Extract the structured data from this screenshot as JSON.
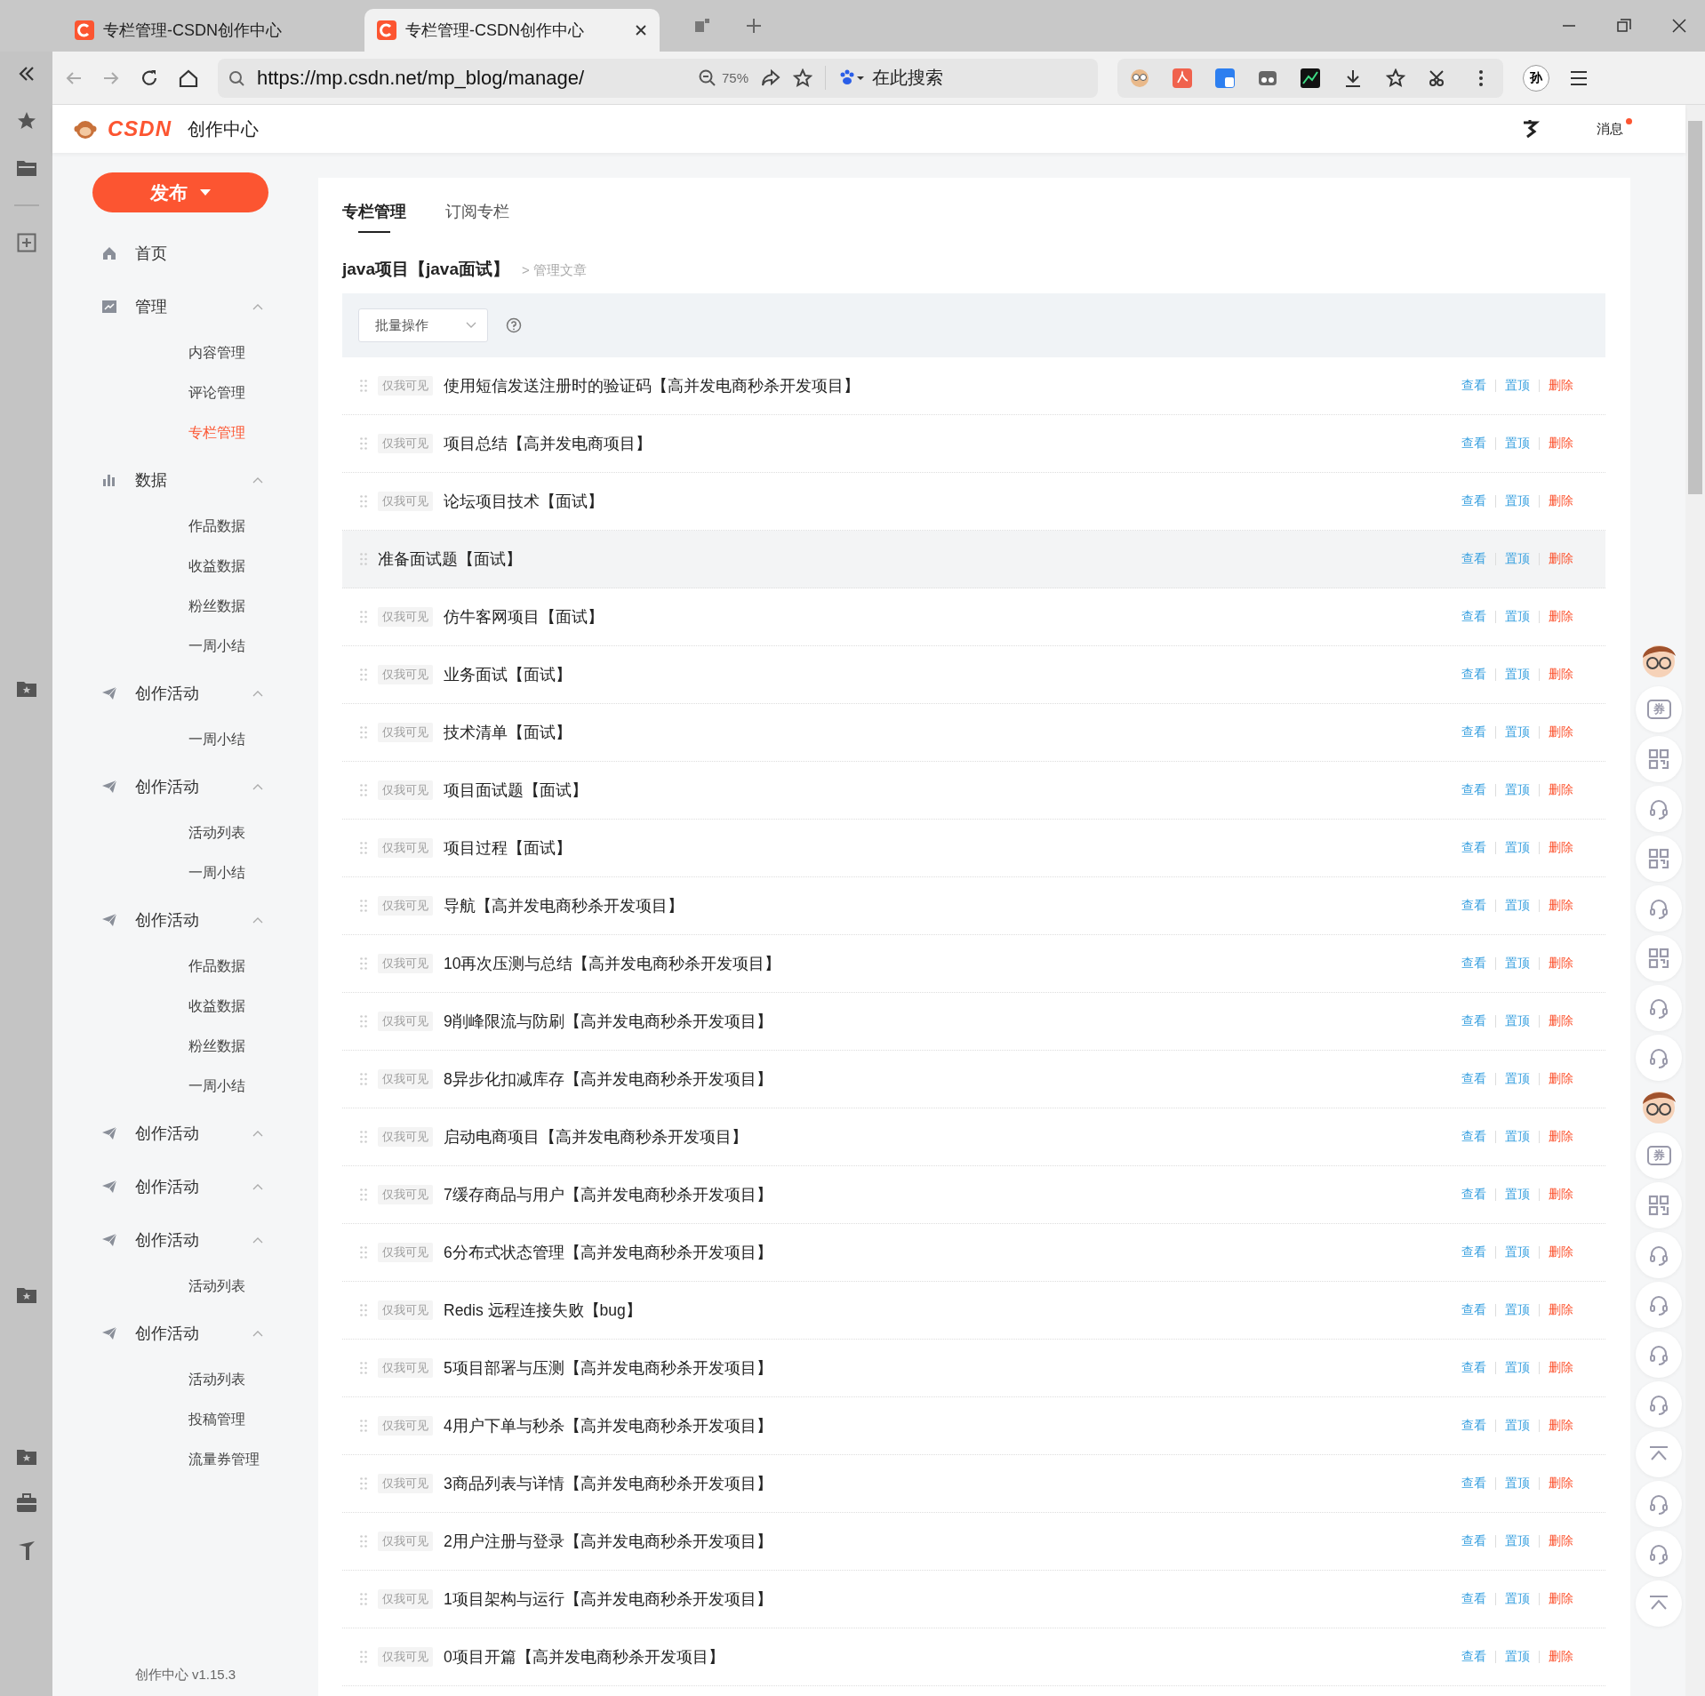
{
  "browser": {
    "tabs": [
      {
        "title": "专栏管理-CSDN创作中心",
        "selected": false
      },
      {
        "title": "专栏管理-CSDN创作中心",
        "selected": true
      }
    ],
    "url": "https://mp.csdn.net/mp_blog/manage/",
    "zoom": "75%",
    "search_placeholder": "在此搜索",
    "profile": "孙"
  },
  "header": {
    "logo": "CSDN",
    "title": "创作中心",
    "messages": "消息",
    "unread": true
  },
  "publish_button": "发布",
  "sidebar": {
    "items": [
      {
        "kind": "link",
        "label": "首页"
      },
      {
        "kind": "group",
        "label": "管理",
        "expanded": true
      },
      {
        "kind": "sub",
        "label": "内容管理",
        "selected": false
      },
      {
        "kind": "sub",
        "label": "评论管理",
        "selected": false
      },
      {
        "kind": "sub",
        "label": "专栏管理",
        "selected": true
      },
      {
        "kind": "group",
        "label": "数据",
        "expanded": true
      },
      {
        "kind": "sub",
        "label": "作品数据",
        "selected": false
      },
      {
        "kind": "sub",
        "label": "收益数据",
        "selected": false
      },
      {
        "kind": "sub",
        "label": "粉丝数据",
        "selected": false
      },
      {
        "kind": "sub",
        "label": "一周小结",
        "selected": false
      },
      {
        "kind": "group",
        "label": "创作活动",
        "expanded": true
      },
      {
        "kind": "sub",
        "label": "一周小结",
        "selected": false
      },
      {
        "kind": "group",
        "label": "创作活动",
        "expanded": true
      },
      {
        "kind": "sub",
        "label": "活动列表",
        "selected": false
      },
      {
        "kind": "sub",
        "label": "一周小结",
        "selected": false
      },
      {
        "kind": "group",
        "label": "创作活动",
        "expanded": true
      },
      {
        "kind": "sub",
        "label": "作品数据",
        "selected": false
      },
      {
        "kind": "sub",
        "label": "收益数据",
        "selected": false
      },
      {
        "kind": "sub",
        "label": "粉丝数据",
        "selected": false
      },
      {
        "kind": "sub",
        "label": "一周小结",
        "selected": false
      },
      {
        "kind": "group",
        "label": "创作活动",
        "expanded": true
      },
      {
        "kind": "group",
        "label": "创作活动",
        "expanded": true
      },
      {
        "kind": "group",
        "label": "创作活动",
        "expanded": true
      },
      {
        "kind": "sub",
        "label": "活动列表",
        "selected": false
      },
      {
        "kind": "group",
        "label": "创作活动",
        "expanded": true
      },
      {
        "kind": "sub",
        "label": "活动列表",
        "selected": false
      },
      {
        "kind": "sub",
        "label": "投稿管理",
        "selected": false
      },
      {
        "kind": "sub",
        "label": "流量券管理",
        "selected": false
      }
    ],
    "version": "创作中心 v1.15.3"
  },
  "content": {
    "tabs": [
      {
        "label": "专栏管理",
        "selected": true
      },
      {
        "label": "订阅专栏",
        "selected": false
      }
    ],
    "column_title": "java项目【java面试】",
    "breadcrumb": "> 管理文章",
    "batch_select": "批量操作",
    "articles": [
      {
        "badge": "仅我可见",
        "title": "使用短信发送注册时的验证码【高并发电商秒杀开发项目】",
        "hovered": false,
        "actions": [
          "查看",
          "置顶",
          "删除"
        ]
      },
      {
        "badge": "仅我可见",
        "title": "项目总结【高并发电商项目】",
        "hovered": false,
        "actions": [
          "查看",
          "置顶",
          "删除"
        ]
      },
      {
        "badge": "仅我可见",
        "title": "论坛项目技术【面试】",
        "hovered": false,
        "actions": [
          "查看",
          "置顶",
          "删除"
        ]
      },
      {
        "title": "准备面试题【面试】",
        "hovered": true,
        "actions": [
          "查看",
          "置顶",
          "删除"
        ]
      },
      {
        "badge": "仅我可见",
        "title": "仿牛客网项目【面试】",
        "hovered": false,
        "actions": [
          "查看",
          "置顶",
          "删除"
        ]
      },
      {
        "badge": "仅我可见",
        "title": "业务面试【面试】",
        "hovered": false,
        "actions": [
          "查看",
          "置顶",
          "删除"
        ]
      },
      {
        "badge": "仅我可见",
        "title": "技术清单【面试】",
        "hovered": false,
        "actions": [
          "查看",
          "置顶",
          "删除"
        ]
      },
      {
        "badge": "仅我可见",
        "title": "项目面试题【面试】",
        "hovered": false,
        "actions": [
          "查看",
          "置顶",
          "删除"
        ]
      },
      {
        "badge": "仅我可见",
        "title": "项目过程【面试】",
        "hovered": false,
        "actions": [
          "查看",
          "置顶",
          "删除"
        ]
      },
      {
        "badge": "仅我可见",
        "title": "导航【高并发电商秒杀开发项目】",
        "hovered": false,
        "actions": [
          "查看",
          "置顶",
          "删除"
        ]
      },
      {
        "badge": "仅我可见",
        "title": "10再次压测与总结【高并发电商秒杀开发项目】",
        "hovered": false,
        "actions": [
          "查看",
          "置顶",
          "删除"
        ]
      },
      {
        "badge": "仅我可见",
        "title": "9削峰限流与防刷【高并发电商秒杀开发项目】",
        "hovered": false,
        "actions": [
          "查看",
          "置顶",
          "删除"
        ]
      },
      {
        "badge": "仅我可见",
        "title": "8异步化扣减库存【高并发电商秒杀开发项目】",
        "hovered": false,
        "actions": [
          "查看",
          "置顶",
          "删除"
        ]
      },
      {
        "badge": "仅我可见",
        "title": "启动电商项目【高并发电商秒杀开发项目】",
        "hovered": false,
        "actions": [
          "查看",
          "置顶",
          "删除"
        ]
      },
      {
        "badge": "仅我可见",
        "title": "7缓存商品与用户【高并发电商秒杀开发项目】",
        "hovered": false,
        "actions": [
          "查看",
          "置顶",
          "删除"
        ]
      },
      {
        "badge": "仅我可见",
        "title": "6分布式状态管理【高并发电商秒杀开发项目】",
        "hovered": false,
        "actions": [
          "查看",
          "置顶",
          "删除"
        ]
      },
      {
        "badge": "仅我可见",
        "title": "Redis 远程连接失败【bug】",
        "hovered": false,
        "actions": [
          "查看",
          "置顶",
          "删除"
        ]
      },
      {
        "badge": "仅我可见",
        "title": "5项目部署与压测【高并发电商秒杀开发项目】",
        "hovered": false,
        "actions": [
          "查看",
          "置顶",
          "删除"
        ]
      },
      {
        "badge": "仅我可见",
        "title": "4用户下单与秒杀【高并发电商秒杀开发项目】",
        "hovered": false,
        "actions": [
          "查看",
          "置顶",
          "删除"
        ]
      },
      {
        "badge": "仅我可见",
        "title": "3商品列表与详情【高并发电商秒杀开发项目】",
        "hovered": false,
        "actions": [
          "查看",
          "置顶",
          "删除"
        ]
      },
      {
        "badge": "仅我可见",
        "title": "2用户注册与登录【高并发电商秒杀开发项目】",
        "hovered": false,
        "actions": [
          "查看",
          "置顶",
          "删除"
        ]
      },
      {
        "badge": "仅我可见",
        "title": "1项目架构与运行【高并发电商秒杀开发项目】",
        "hovered": false,
        "actions": [
          "查看",
          "置顶",
          "删除"
        ]
      },
      {
        "badge": "仅我可见",
        "title": "0项目开篇【高并发电商秒杀开发项目】",
        "hovered": false,
        "actions": [
          "查看",
          "置顶",
          "删除"
        ]
      }
    ]
  },
  "float_buttons": [
    {
      "kind": "mascot"
    },
    {
      "kind": "coupon",
      "label": "券"
    },
    {
      "kind": "qr"
    },
    {
      "kind": "headset"
    },
    {
      "kind": "qr"
    },
    {
      "kind": "headset"
    },
    {
      "kind": "qr"
    },
    {
      "kind": "headset"
    },
    {
      "kind": "headset"
    },
    {
      "kind": "mascot"
    },
    {
      "kind": "coupon",
      "label": "券"
    },
    {
      "kind": "qr"
    },
    {
      "kind": "headset"
    },
    {
      "kind": "headset"
    },
    {
      "kind": "headset"
    },
    {
      "kind": "headset"
    },
    {
      "kind": "top"
    },
    {
      "kind": "headset"
    },
    {
      "kind": "headset"
    },
    {
      "kind": "top"
    }
  ]
}
